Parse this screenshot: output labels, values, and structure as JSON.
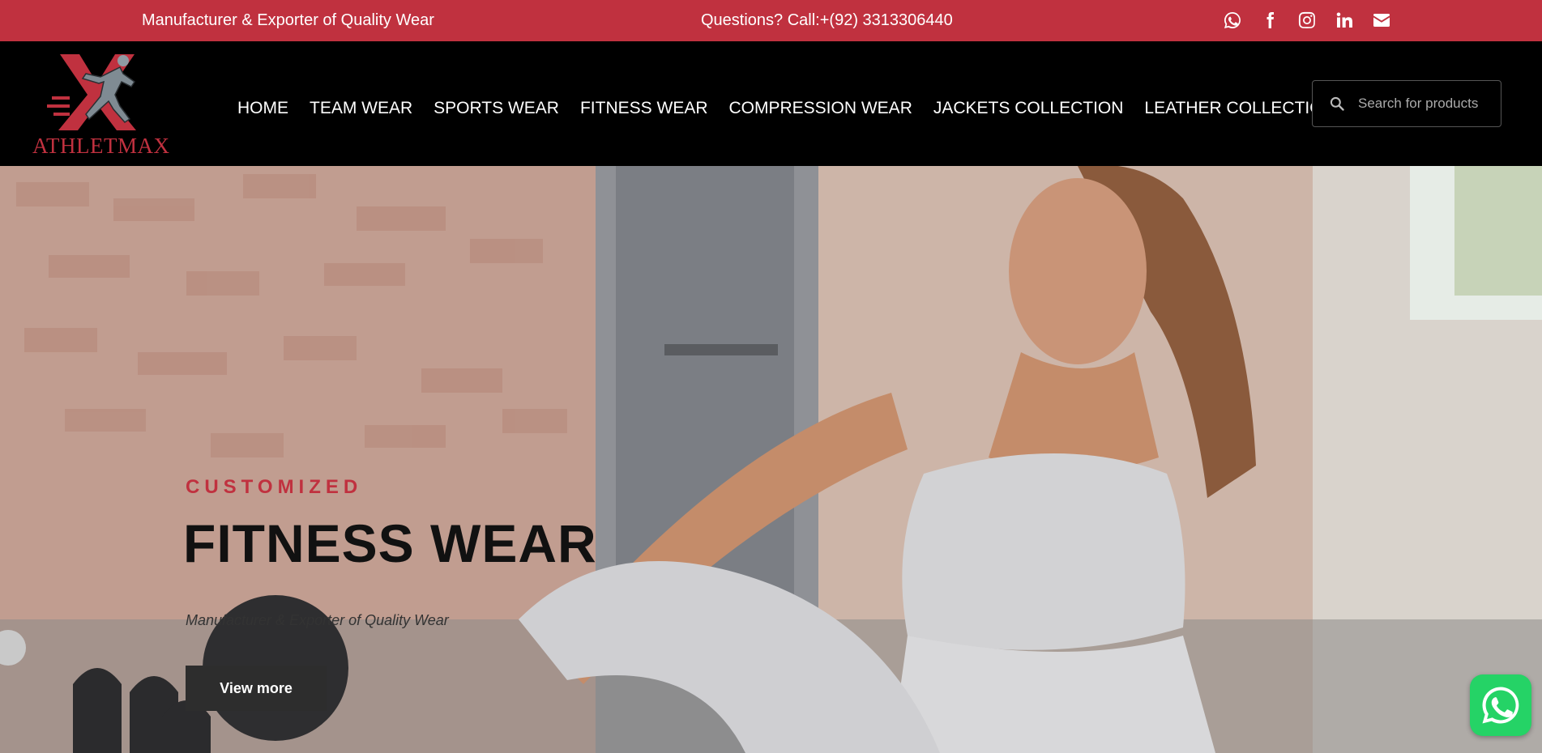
{
  "topbar": {
    "tagline": "Manufacturer & Exporter of Quality Wear",
    "phone": "Questions? Call:+(92) 3313306440",
    "socials": [
      "whatsapp-icon",
      "facebook-icon",
      "instagram-icon",
      "linkedin-icon",
      "envelope-icon"
    ]
  },
  "header": {
    "logo_text": "ATHLETMAX",
    "nav": [
      "HOME",
      "TEAM WEAR",
      "SPORTS WEAR",
      "FITNESS WEAR",
      "COMPRESSION WEAR",
      "JACKETS COLLECTION",
      "LEATHER COLLECTION"
    ],
    "search_placeholder": "Search for products"
  },
  "hero": {
    "eyebrow": "CUSTOMIZED",
    "headline": "FITNESS WEAR",
    "subtitle": "Manufacturer & Exporter of Quality Wear",
    "button_label": "View more"
  },
  "colors": {
    "brand_red": "#c0313f",
    "header_bg": "#000000",
    "button_bg": "#2d2d2d",
    "whatsapp_green": "#25d366"
  }
}
